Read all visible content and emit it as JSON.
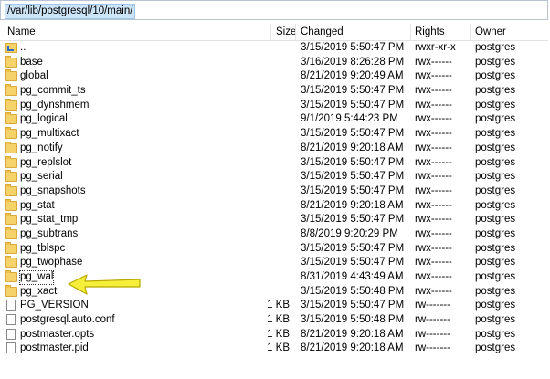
{
  "path": "/var/lib/postgresql/10/main/",
  "columns": {
    "name": "Name",
    "size": "Size",
    "changed": "Changed",
    "rights": "Rights",
    "owner": "Owner"
  },
  "rows": [
    {
      "name": "..",
      "size": "",
      "changed": "3/15/2019 5:50:47 PM",
      "rights": "rwxr-xr-x",
      "owner": "postgres",
      "type": "up"
    },
    {
      "name": "base",
      "size": "",
      "changed": "3/16/2019 8:26:28 PM",
      "rights": "rwx------",
      "owner": "postgres",
      "type": "folder"
    },
    {
      "name": "global",
      "size": "",
      "changed": "8/21/2019 9:20:49 AM",
      "rights": "rwx------",
      "owner": "postgres",
      "type": "folder"
    },
    {
      "name": "pg_commit_ts",
      "size": "",
      "changed": "3/15/2019 5:50:47 PM",
      "rights": "rwx------",
      "owner": "postgres",
      "type": "folder"
    },
    {
      "name": "pg_dynshmem",
      "size": "",
      "changed": "3/15/2019 5:50:47 PM",
      "rights": "rwx------",
      "owner": "postgres",
      "type": "folder"
    },
    {
      "name": "pg_logical",
      "size": "",
      "changed": "9/1/2019 5:44:23 PM",
      "rights": "rwx------",
      "owner": "postgres",
      "type": "folder"
    },
    {
      "name": "pg_multixact",
      "size": "",
      "changed": "3/15/2019 5:50:47 PM",
      "rights": "rwx------",
      "owner": "postgres",
      "type": "folder"
    },
    {
      "name": "pg_notify",
      "size": "",
      "changed": "8/21/2019 9:20:18 AM",
      "rights": "rwx------",
      "owner": "postgres",
      "type": "folder"
    },
    {
      "name": "pg_replslot",
      "size": "",
      "changed": "3/15/2019 5:50:47 PM",
      "rights": "rwx------",
      "owner": "postgres",
      "type": "folder"
    },
    {
      "name": "pg_serial",
      "size": "",
      "changed": "3/15/2019 5:50:47 PM",
      "rights": "rwx------",
      "owner": "postgres",
      "type": "folder"
    },
    {
      "name": "pg_snapshots",
      "size": "",
      "changed": "3/15/2019 5:50:47 PM",
      "rights": "rwx------",
      "owner": "postgres",
      "type": "folder"
    },
    {
      "name": "pg_stat",
      "size": "",
      "changed": "8/21/2019 9:20:18 AM",
      "rights": "rwx------",
      "owner": "postgres",
      "type": "folder"
    },
    {
      "name": "pg_stat_tmp",
      "size": "",
      "changed": "3/15/2019 5:50:47 PM",
      "rights": "rwx------",
      "owner": "postgres",
      "type": "folder"
    },
    {
      "name": "pg_subtrans",
      "size": "",
      "changed": "8/8/2019 9:20:29 PM",
      "rights": "rwx------",
      "owner": "postgres",
      "type": "folder"
    },
    {
      "name": "pg_tblspc",
      "size": "",
      "changed": "3/15/2019 5:50:47 PM",
      "rights": "rwx------",
      "owner": "postgres",
      "type": "folder"
    },
    {
      "name": "pg_twophase",
      "size": "",
      "changed": "3/15/2019 5:50:47 PM",
      "rights": "rwx------",
      "owner": "postgres",
      "type": "folder"
    },
    {
      "name": "pg_wal",
      "size": "",
      "changed": "8/31/2019 4:43:49 AM",
      "rights": "rwx------",
      "owner": "postgres",
      "type": "folder",
      "selected": true
    },
    {
      "name": "pg_xact",
      "size": "",
      "changed": "3/15/2019 5:50:48 PM",
      "rights": "rwx------",
      "owner": "postgres",
      "type": "folder"
    },
    {
      "name": "PG_VERSION",
      "size": "1 KB",
      "changed": "3/15/2019 5:50:47 PM",
      "rights": "rw-------",
      "owner": "postgres",
      "type": "file"
    },
    {
      "name": "postgresql.auto.conf",
      "size": "1 KB",
      "changed": "3/15/2019 5:50:48 PM",
      "rights": "rw-------",
      "owner": "postgres",
      "type": "file"
    },
    {
      "name": "postmaster.opts",
      "size": "1 KB",
      "changed": "8/21/2019 9:20:18 AM",
      "rights": "rw-------",
      "owner": "postgres",
      "type": "file"
    },
    {
      "name": "postmaster.pid",
      "size": "1 KB",
      "changed": "8/21/2019 9:20:18 AM",
      "rights": "rw-------",
      "owner": "postgres",
      "type": "file"
    }
  ],
  "annotation": {
    "arrow_color": "#f5ee3a",
    "arrow_outline": "#b8a800",
    "icon": "arrow-pointing-left-icon"
  }
}
